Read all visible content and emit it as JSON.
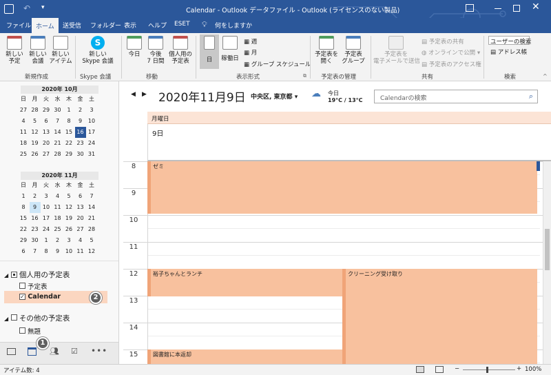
{
  "window": {
    "title": "Calendar - Outlook データファイル - Outlook (ライセンスのない製品)"
  },
  "menu": {
    "items": [
      "ファイル",
      "ホーム",
      "送受信",
      "フォルダー",
      "表示",
      "ヘルプ",
      "ESET"
    ],
    "search_prompt": "何をしますか"
  },
  "ribbon": {
    "new_appointment": "新しい\n予定",
    "new_meeting": "新しい\n会議",
    "new_items": "新しい\nアイテム",
    "group_new": "新規作成",
    "new_skype": "新しい\nSkype 会議",
    "group_skype": "Skype 会議",
    "today": "今日",
    "next7": "今後\n7 日間",
    "personal_cal": "個人用の\n予定表",
    "group_move": "移動",
    "day": "日",
    "workweek": "稼働日",
    "week": "週",
    "month": "月",
    "group_schedule": "グループ スケジュール",
    "group_arrange": "表示形式",
    "open_cal": "予定表を\n開く",
    "cal_groups": "予定表\nグループ",
    "group_manage": "予定表の管理",
    "email_cal": "予定表を\n電子メールで送信",
    "share_cal": "予定表の共有",
    "publish_online": "オンラインで公開",
    "cal_permissions": "予定表のアクセス権",
    "group_share": "共有",
    "address_search": "ユーザーの検索",
    "address_book": "アドレス帳",
    "group_find": "検索"
  },
  "mini_cal_oct": {
    "caption": "2020年 10月",
    "weekdays": [
      "日",
      "月",
      "火",
      "水",
      "木",
      "金",
      "土"
    ],
    "weeks": [
      [
        "27",
        "28",
        "29",
        "30",
        "1",
        "2",
        "3"
      ],
      [
        "4",
        "5",
        "6",
        "7",
        "8",
        "9",
        "10"
      ],
      [
        "11",
        "12",
        "13",
        "14",
        "15",
        "16",
        "17"
      ],
      [
        "18",
        "19",
        "20",
        "21",
        "22",
        "23",
        "24"
      ],
      [
        "25",
        "26",
        "27",
        "28",
        "29",
        "30",
        "31"
      ]
    ]
  },
  "mini_cal_nov": {
    "caption": "2020年 11月",
    "weekdays": [
      "日",
      "月",
      "火",
      "水",
      "木",
      "金",
      "土"
    ],
    "weeks": [
      [
        "1",
        "2",
        "3",
        "4",
        "5",
        "6",
        "7"
      ],
      [
        "8",
        "9",
        "10",
        "11",
        "12",
        "13",
        "14"
      ],
      [
        "15",
        "16",
        "17",
        "18",
        "19",
        "20",
        "21"
      ],
      [
        "22",
        "23",
        "24",
        "25",
        "26",
        "27",
        "28"
      ],
      [
        "29",
        "30",
        "1",
        "2",
        "3",
        "4",
        "5"
      ],
      [
        "6",
        "7",
        "8",
        "9",
        "10",
        "11",
        "12"
      ]
    ]
  },
  "calendars": {
    "personal_header": "個人用の予定表",
    "personal_items": [
      "予定表",
      "Calendar"
    ],
    "other_header": "その他の予定表",
    "other_items": [
      "無題"
    ]
  },
  "badges": [
    "2",
    "1"
  ],
  "calendar_view": {
    "date_title": "2020年11月9日",
    "location": "中央区, 東京都",
    "weather_today": "今日",
    "weather_temp": "19°C / 13°C",
    "search_placeholder": "Calendarの検索",
    "day_header": "月曜日",
    "day_num": "9日",
    "hours": [
      "8",
      "9",
      "10",
      "11",
      "12",
      "13",
      "14",
      "15"
    ],
    "appointments": [
      {
        "title": "ゼミ"
      },
      {
        "title": "裕子ちゃんとランチ"
      },
      {
        "title": "クリーニング受け取り"
      },
      {
        "title": "図書館に本返却"
      }
    ]
  },
  "status": {
    "items_count": "アイテム数: 4",
    "zoom": "100%"
  },
  "colors": {
    "titlebar": "#2b579a",
    "appointment": "#f8c19e",
    "appointment_border": "#f0a478",
    "today_highlight": "#2b579a"
  }
}
